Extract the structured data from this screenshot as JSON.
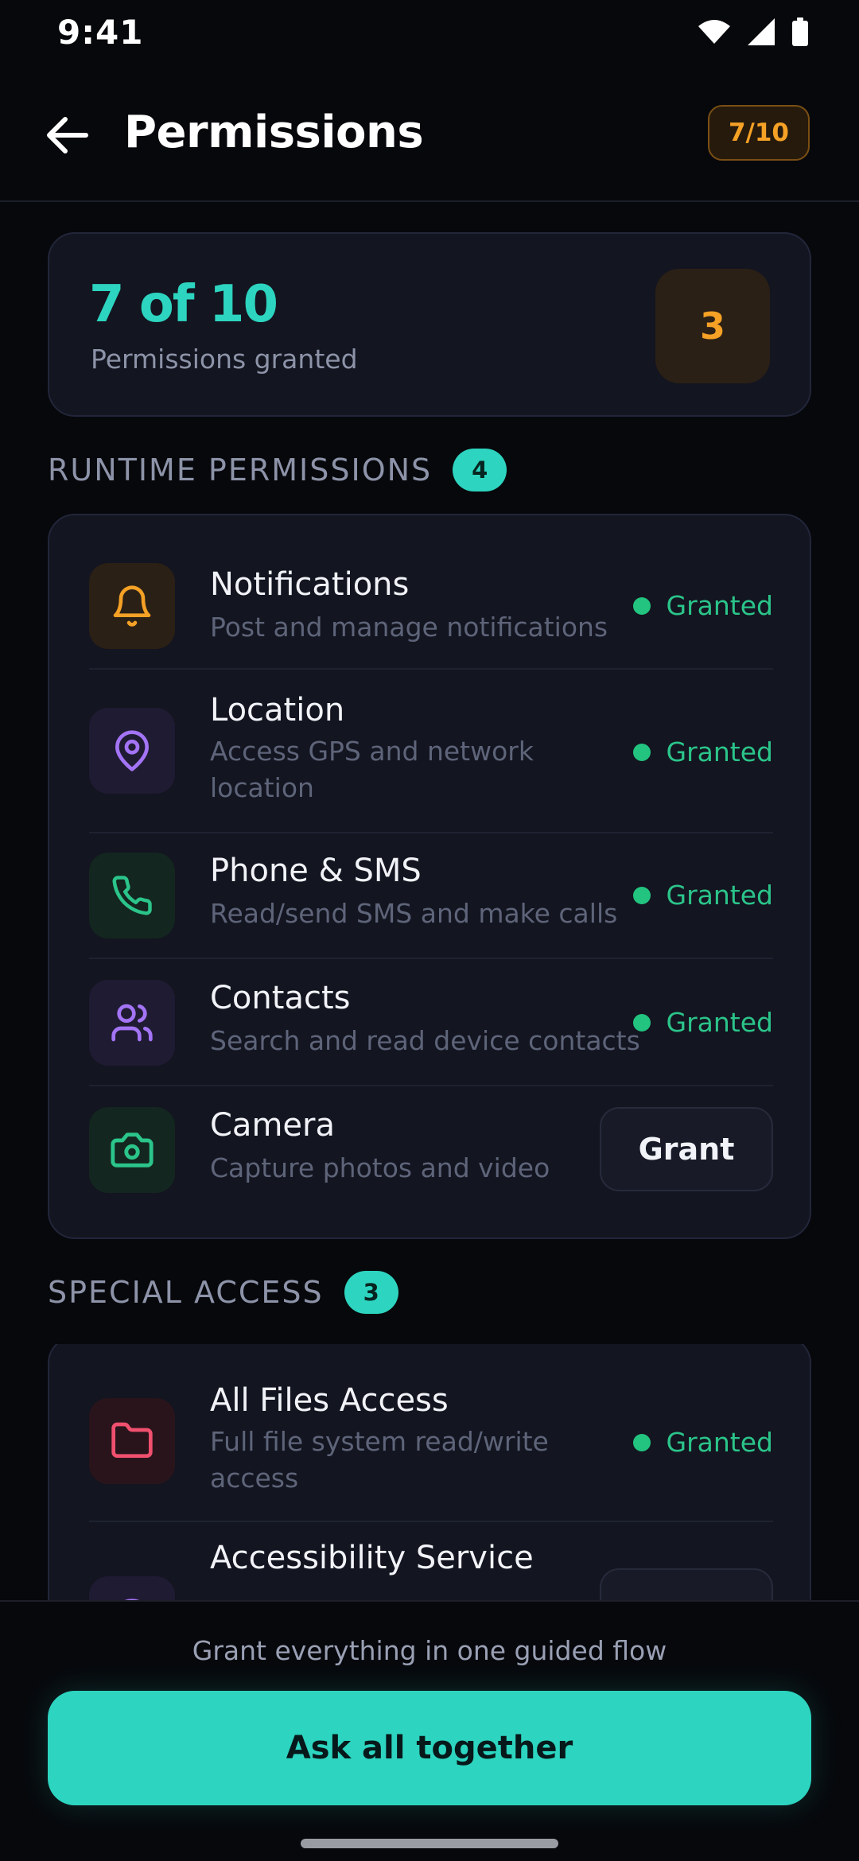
{
  "status_bar": {
    "time": "9:41"
  },
  "header": {
    "title": "Permissions",
    "badge": "7/10"
  },
  "summary": {
    "count": "7 of 10",
    "label": "Permissions granted",
    "pending": "3"
  },
  "runtime": {
    "title": "RUNTIME PERMISSIONS",
    "badge": "4",
    "items": [
      {
        "title": "Notifications",
        "desc": "Post and manage notifications",
        "status": "Granted",
        "icon": "bell-icon",
        "color": "#f4a126"
      },
      {
        "title": "Location",
        "desc": "Access GPS and network location",
        "status": "Granted",
        "icon": "map-pin-icon",
        "color": "#a374f5"
      },
      {
        "title": "Phone & SMS",
        "desc": "Read/send SMS and make calls",
        "status": "Granted",
        "icon": "phone-icon",
        "color": "#2bc48a"
      },
      {
        "title": "Contacts",
        "desc": "Search and read device contacts",
        "status": "Granted",
        "icon": "users-icon",
        "color": "#a374f5"
      },
      {
        "title": "Camera",
        "desc": "Capture photos and video",
        "action": "Grant",
        "icon": "camera-icon",
        "color": "#2bc48a"
      }
    ]
  },
  "special": {
    "title": "SPECIAL ACCESS",
    "badge": "3",
    "items": [
      {
        "title": "All Files Access",
        "desc": "Full file system read/write access",
        "status": "Granted",
        "icon": "folder-icon",
        "color": "#f0506e"
      },
      {
        "title": "Accessibility Service",
        "icon": "accessibility-icon",
        "color": "#a374f5"
      }
    ]
  },
  "footer": {
    "hint": "Grant everything in one guided flow",
    "cta": "Ask all together"
  }
}
